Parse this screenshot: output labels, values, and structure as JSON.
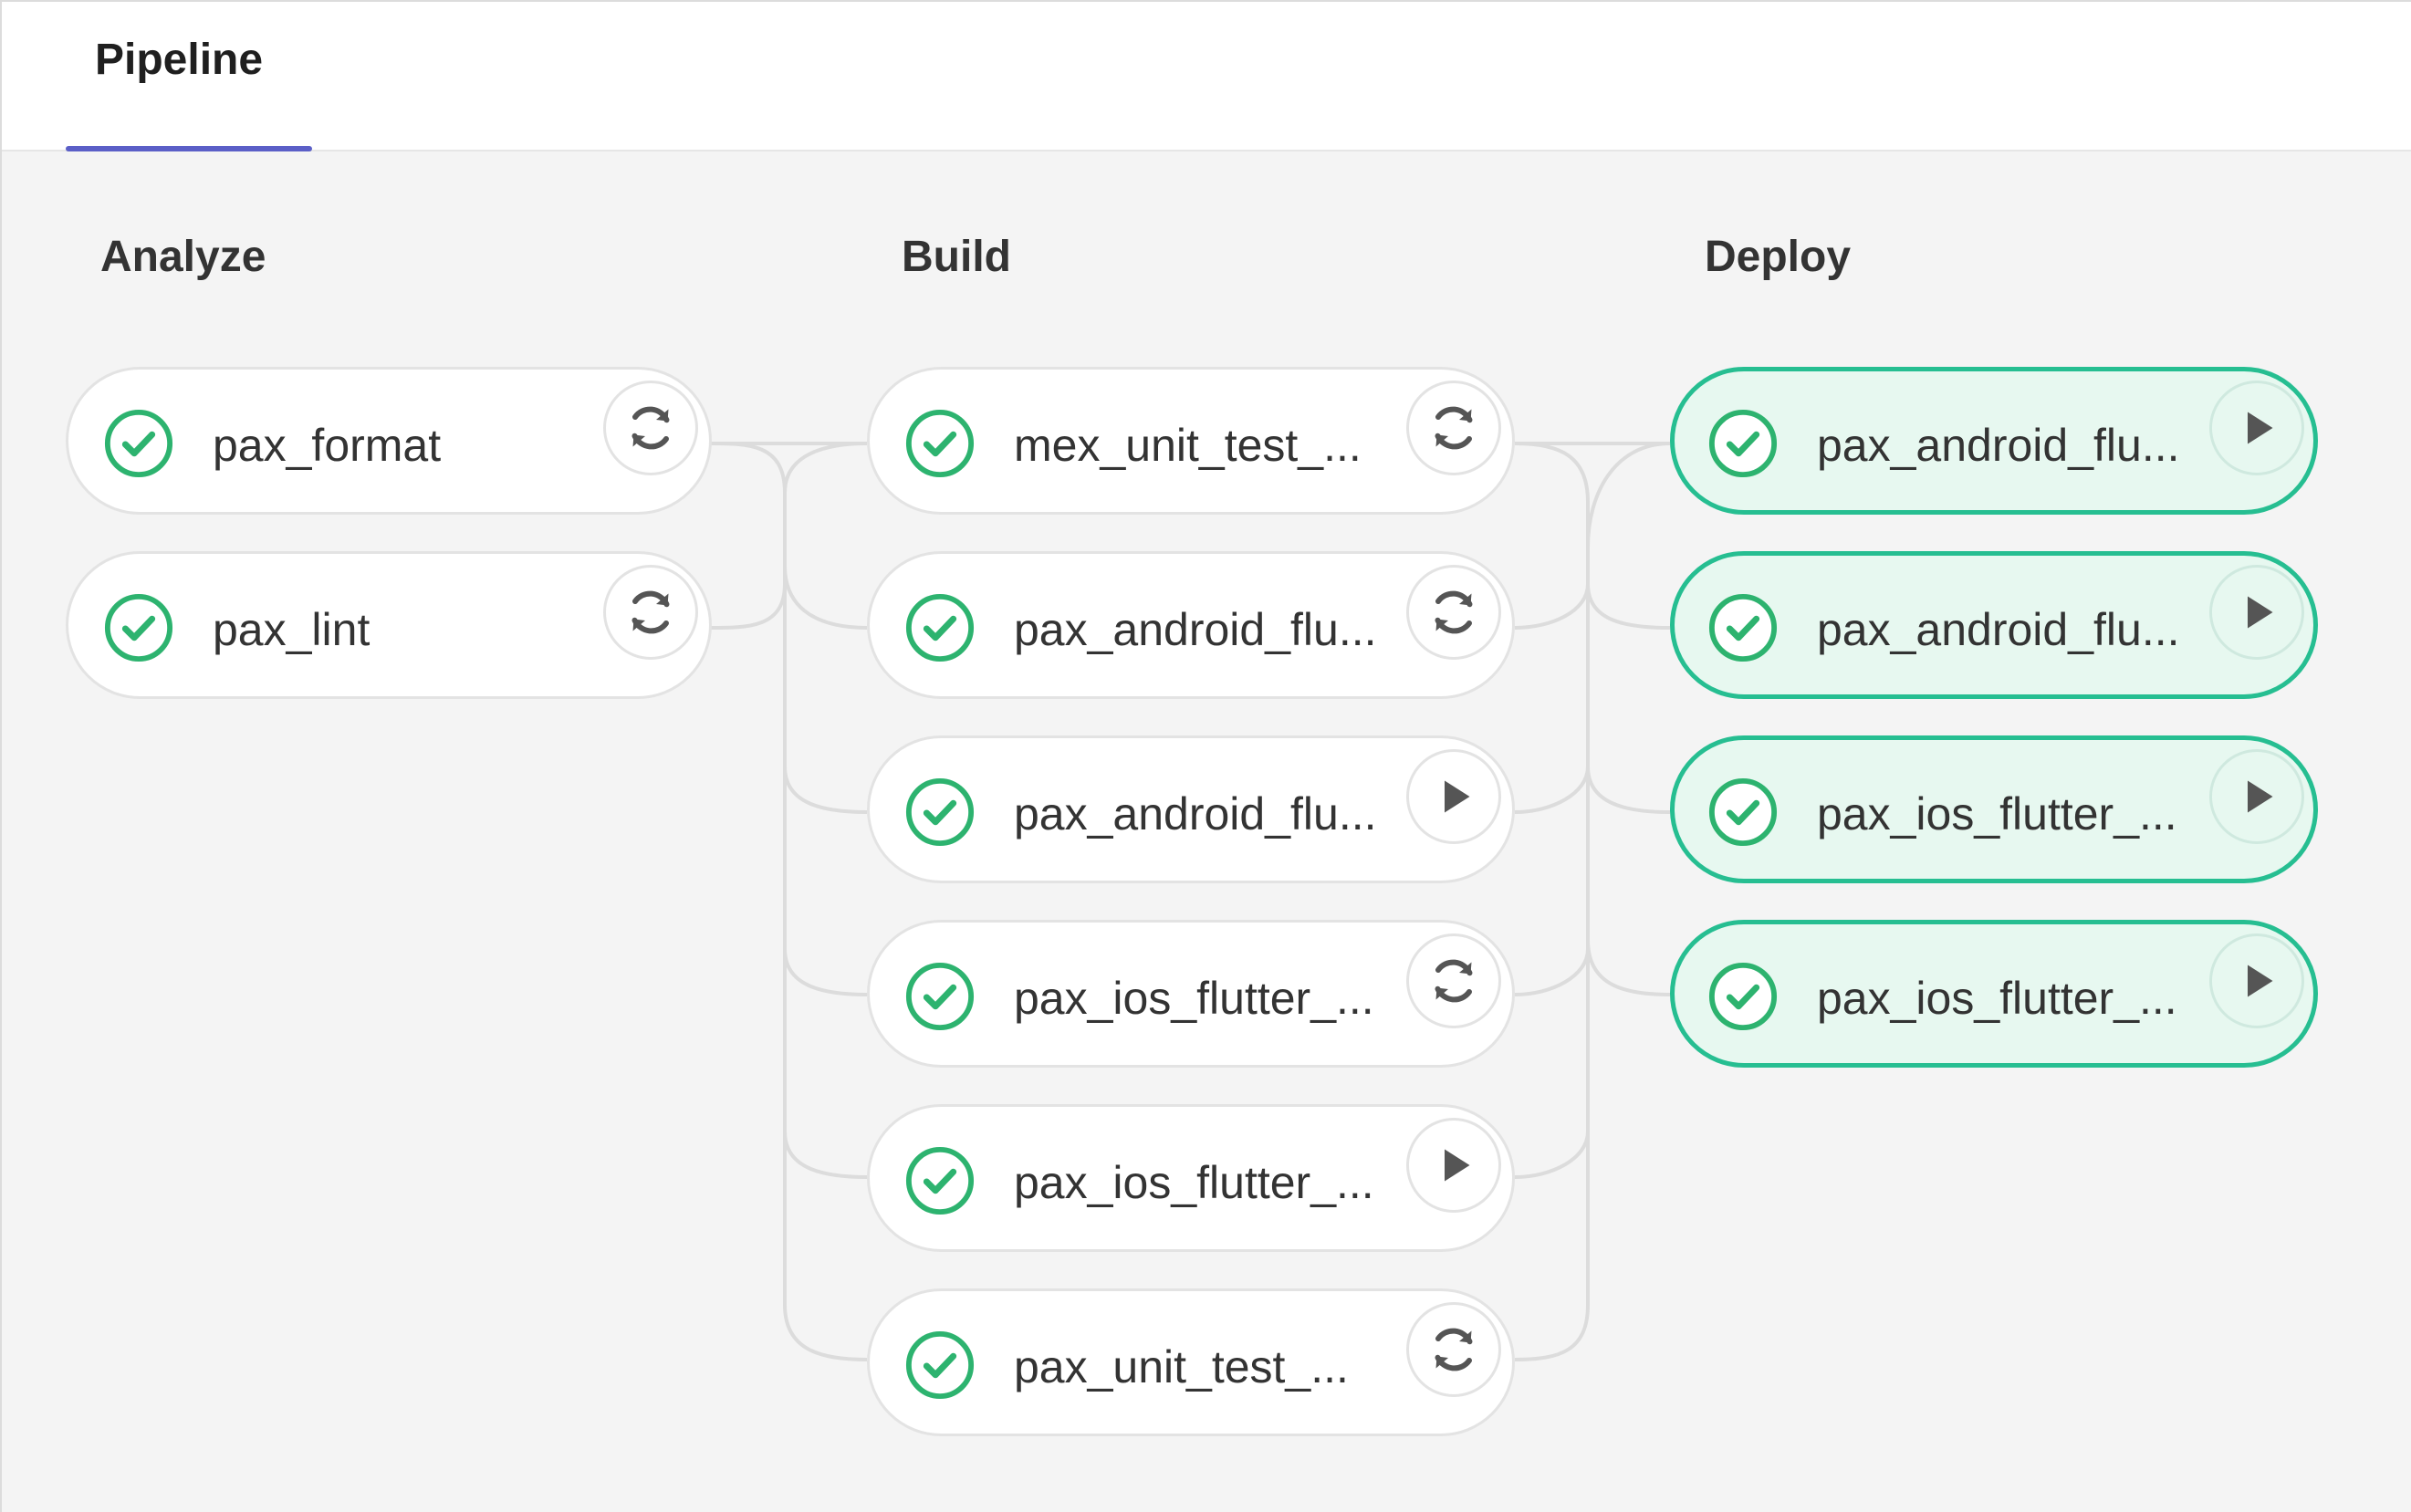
{
  "tabs": [
    {
      "label": "Pipeline",
      "active": true
    }
  ],
  "colors": {
    "accent": "#5b5fc7",
    "success": "#2db36f",
    "highlight_border": "#26be91",
    "highlight_bg": "#e7f8f0"
  },
  "stages": [
    {
      "title": "Analyze",
      "jobs": [
        {
          "name": "pax_format",
          "status": "success",
          "action": "retry",
          "action_icon": "retry-icon"
        },
        {
          "name": "pax_lint",
          "status": "success",
          "action": "retry",
          "action_icon": "retry-icon"
        }
      ]
    },
    {
      "title": "Build",
      "jobs": [
        {
          "name": "mex_unit_test_...",
          "status": "success",
          "action": "retry",
          "action_icon": "retry-icon"
        },
        {
          "name": "pax_android_flu...",
          "status": "success",
          "action": "retry",
          "action_icon": "retry-icon"
        },
        {
          "name": "pax_android_flu...",
          "status": "success",
          "action": "play",
          "action_icon": "play-icon"
        },
        {
          "name": "pax_ios_flutter_...",
          "status": "success",
          "action": "retry",
          "action_icon": "retry-icon"
        },
        {
          "name": "pax_ios_flutter_...",
          "status": "success",
          "action": "play",
          "action_icon": "play-icon"
        },
        {
          "name": "pax_unit_test_...",
          "status": "success",
          "action": "retry",
          "action_icon": "retry-icon"
        }
      ]
    },
    {
      "title": "Deploy",
      "jobs": [
        {
          "name": "pax_android_flu...",
          "status": "success",
          "action": "play",
          "action_icon": "play-icon"
        },
        {
          "name": "pax_android_flu...",
          "status": "success",
          "action": "play",
          "action_icon": "play-icon"
        },
        {
          "name": "pax_ios_flutter_...",
          "status": "success",
          "action": "play",
          "action_icon": "play-icon"
        },
        {
          "name": "pax_ios_flutter_...",
          "status": "success",
          "action": "play",
          "action_icon": "play-icon"
        }
      ]
    }
  ]
}
